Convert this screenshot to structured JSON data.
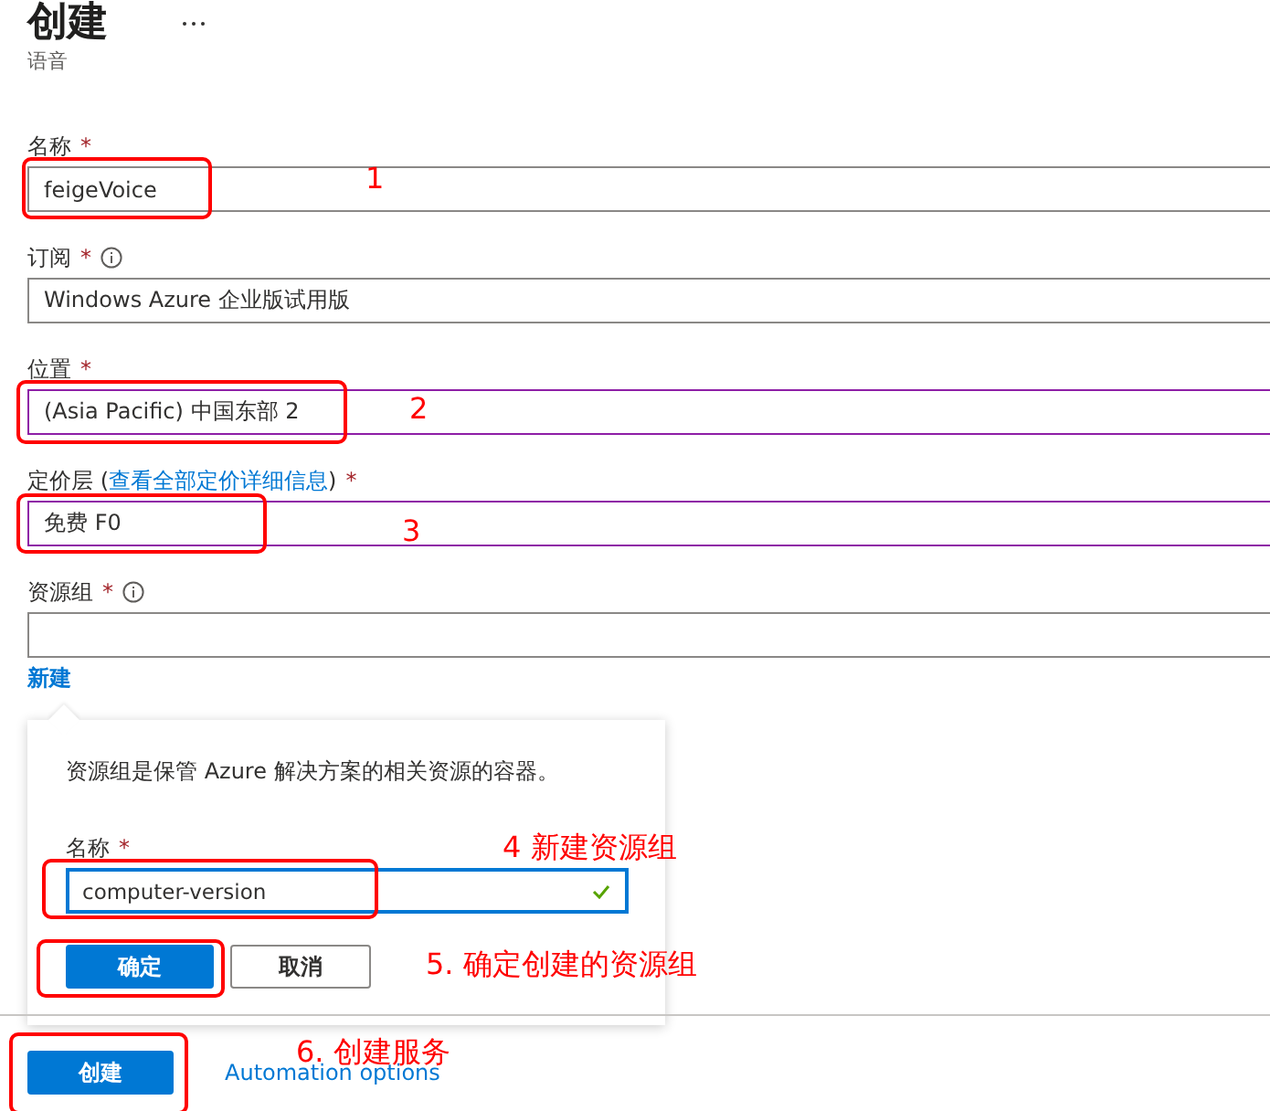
{
  "header": {
    "title": "创建",
    "subtitle": "语音"
  },
  "fields": [
    {
      "label": "名称",
      "required_mark": "*",
      "info": false,
      "value": "feigeVoice",
      "highlighted": false,
      "annotation": "1"
    },
    {
      "label": "订阅",
      "required_mark": "*",
      "info": true,
      "value": "Windows Azure 企业版试用版",
      "highlighted": false
    },
    {
      "label": "位置",
      "required_mark": "*",
      "info": false,
      "value": "(Asia Pacific) 中国东部 2",
      "highlighted": true,
      "annotation": "2"
    },
    {
      "label": "定价层 (",
      "link": "查看全部定价详细信息",
      "label_suffix": ")",
      "required_mark": "*",
      "info": false,
      "value": "免费 F0",
      "highlighted": true,
      "annotation": "3"
    },
    {
      "label": "资源组",
      "required_mark": "*",
      "info": true,
      "highlighted": false,
      "new_link": "新建"
    }
  ],
  "popup": {
    "description": "资源组是保管 Azure 解决方案的相关资源的容器。",
    "label": "名称",
    "required_mark": "*",
    "value": "computer-version",
    "valid": true,
    "annotation": "4 新建资源组",
    "buttons": [
      {
        "label": "确定",
        "kind": "primary"
      },
      {
        "label": "取消",
        "kind": "secondary"
      }
    ],
    "buttons_annotation": "5. 确定创建的资源组"
  },
  "footer": {
    "button": "创建",
    "link": "Automation options",
    "annotation": "6. 创建服务"
  }
}
